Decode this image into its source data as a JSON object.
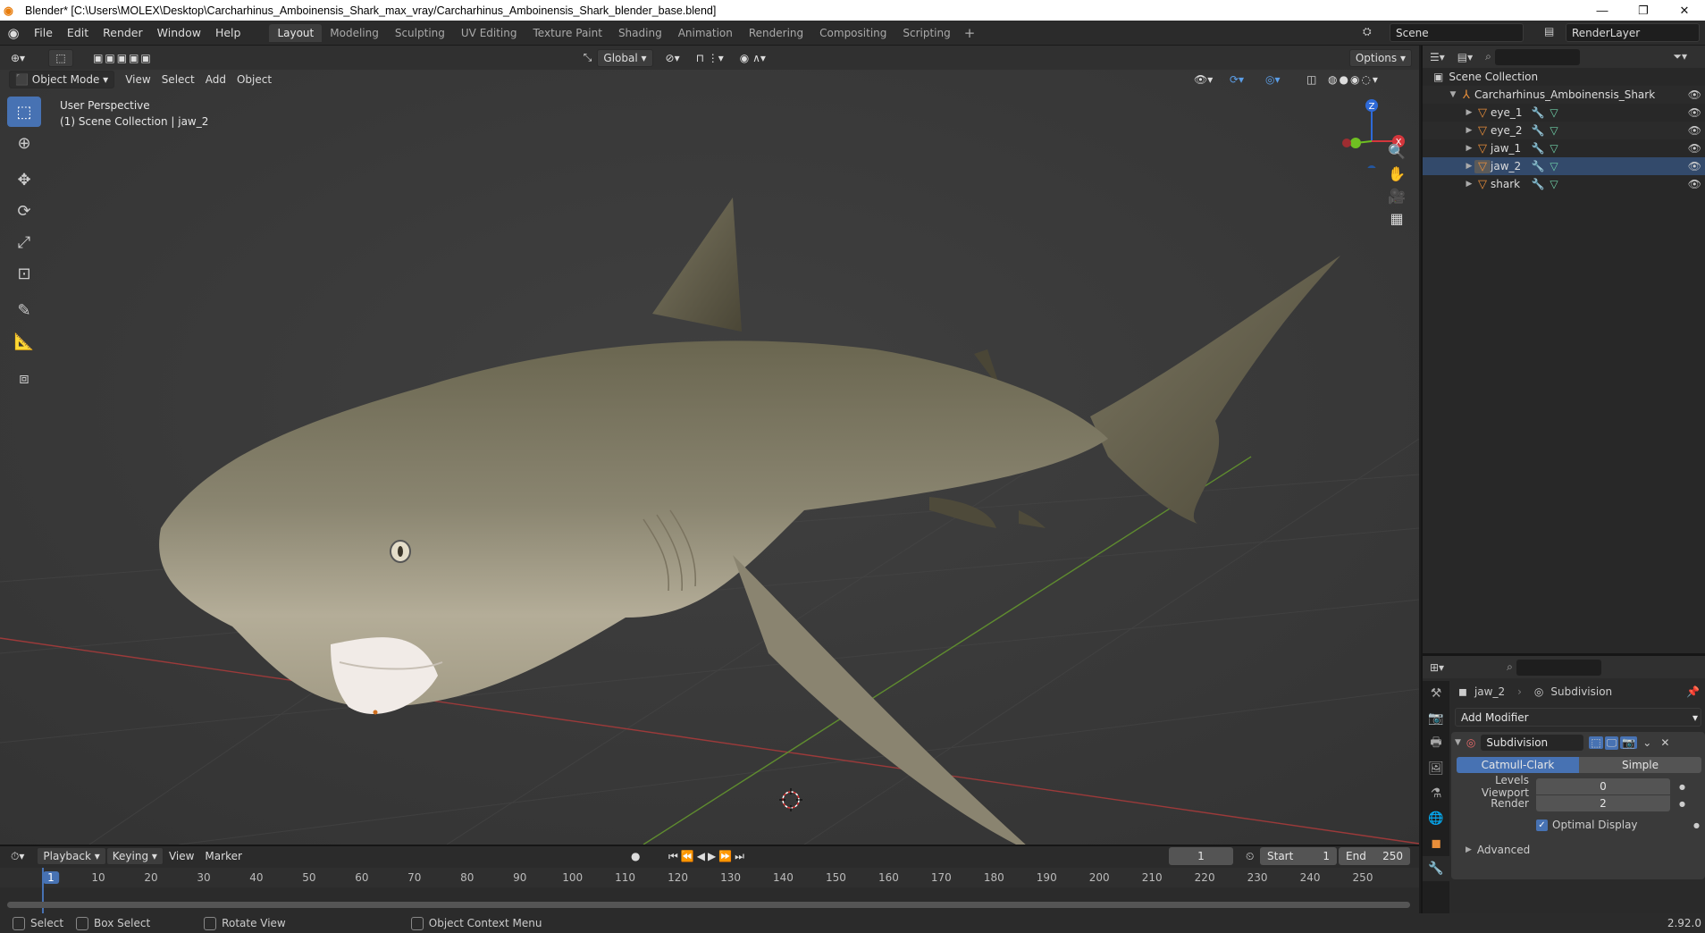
{
  "window": {
    "title": "Blender* [C:\\Users\\MOLEX\\Desktop\\Carcharhinus_Amboinensis_Shark_max_vray/Carcharhinus_Amboinensis_Shark_blender_base.blend]",
    "minimize": "—",
    "maximize": "❐",
    "close": "✕"
  },
  "menubar": {
    "items": [
      "File",
      "Edit",
      "Render",
      "Window",
      "Help"
    ],
    "workspaces": [
      "Layout",
      "Modeling",
      "Sculpting",
      "UV Editing",
      "Texture Paint",
      "Shading",
      "Animation",
      "Rendering",
      "Compositing",
      "Scripting"
    ],
    "add_tab": "+",
    "scene": "Scene",
    "view_layer": "RenderLayer"
  },
  "viewport": {
    "mode": "Object Mode",
    "menus": [
      "View",
      "Select",
      "Add",
      "Object"
    ],
    "transform": "Global",
    "options": "Options",
    "perspective": "User Perspective",
    "collection_info": "(1) Scene Collection | jaw_2",
    "gizmo": {
      "z": "Z",
      "y": "Y",
      "x": "X"
    }
  },
  "outliner": {
    "root": "Scene Collection",
    "collection": "Carcharhinus_Amboinensis_Shark",
    "objects": [
      "eye_1",
      "eye_2",
      "jaw_1",
      "jaw_2",
      "shark"
    ]
  },
  "properties": {
    "object": "jaw_2",
    "modifier_crumb": "Subdivision",
    "add_modifier": "Add Modifier",
    "modifier_name": "Subdivision",
    "type_a": "Catmull-Clark",
    "type_b": "Simple",
    "levels_label": "Levels Viewport",
    "levels_value": "0",
    "render_label": "Render",
    "render_value": "2",
    "optimal_display": "Optimal Display",
    "advanced": "Advanced"
  },
  "timeline": {
    "menus": [
      "Playback",
      "Keying",
      "View",
      "Marker"
    ],
    "current_frame": "1",
    "start_label": "Start",
    "start": "1",
    "end_label": "End",
    "end": "250",
    "ruler": [
      "1",
      "10",
      "20",
      "30",
      "40",
      "50",
      "60",
      "70",
      "80",
      "90",
      "100",
      "110",
      "120",
      "130",
      "140",
      "150",
      "160",
      "170",
      "180",
      "190",
      "200",
      "210",
      "220",
      "230",
      "240",
      "250"
    ]
  },
  "statusbar": {
    "select": "Select",
    "box_select": "Box Select",
    "rotate_view": "Rotate View",
    "context_menu": "Object Context Menu",
    "version": "2.92.0"
  }
}
